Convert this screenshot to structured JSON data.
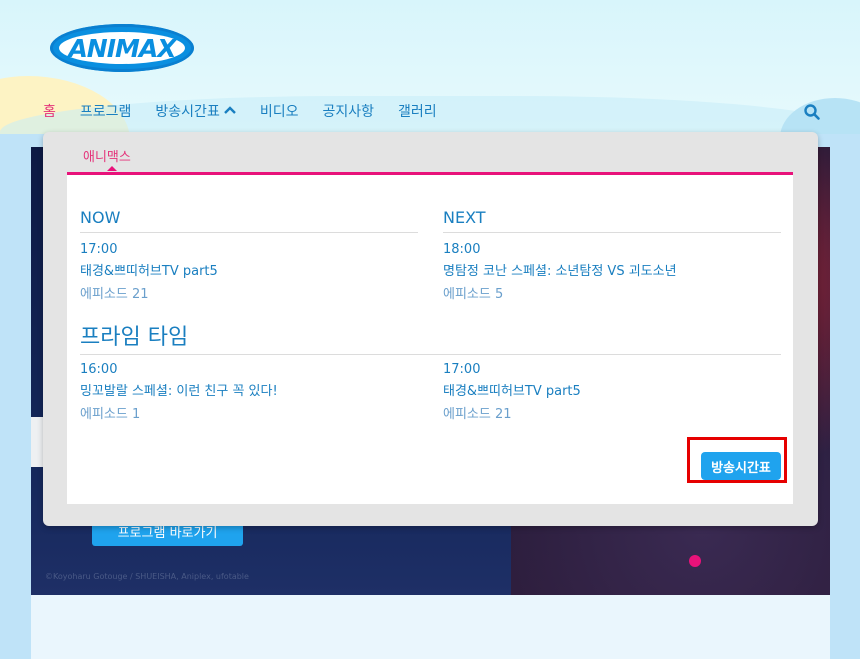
{
  "brand": {
    "logo_text": "ANIMAX"
  },
  "nav": {
    "items": [
      {
        "label": "홈",
        "active": true
      },
      {
        "label": "프로그램",
        "active": false
      },
      {
        "label": "방송시간표",
        "active": false,
        "expanded": true
      },
      {
        "label": "비디오",
        "active": false
      },
      {
        "label": "공지사항",
        "active": false
      },
      {
        "label": "갤러리",
        "active": false
      }
    ],
    "search_icon": "search-icon"
  },
  "dropdown": {
    "tab_label": "애니맥스",
    "now": {
      "heading": "NOW",
      "time": "17:00",
      "title": "태경&쁘띠허브TV part5",
      "episode": "에피소드 21"
    },
    "next": {
      "heading": "NEXT",
      "time": "18:00",
      "title": "명탐정 코난 스페셜: 소년탐정 VS 괴도소년",
      "episode": "에피소드 5"
    },
    "prime_time": {
      "heading": "프라임 타임",
      "left": {
        "time": "16:00",
        "title": "밍꼬발랄 스페셜: 이런 친구 꼭 있다!",
        "episode": "에피소드 1"
      },
      "right": {
        "time": "17:00",
        "title": "태경&쁘띠허브TV part5",
        "episode": "에피소드 21"
      }
    },
    "schedule_button": "방송시간표"
  },
  "hero": {
    "button_label": "프로그램 바로가기",
    "copyright": "©Koyoharu Gotouge / SHUEISHA, Aniplex, ufotable"
  },
  "colors": {
    "accent_pink": "#e8127a",
    "primary_blue": "#1a7fc0",
    "button_blue": "#1fa3ee",
    "highlight_red": "#e60000"
  }
}
